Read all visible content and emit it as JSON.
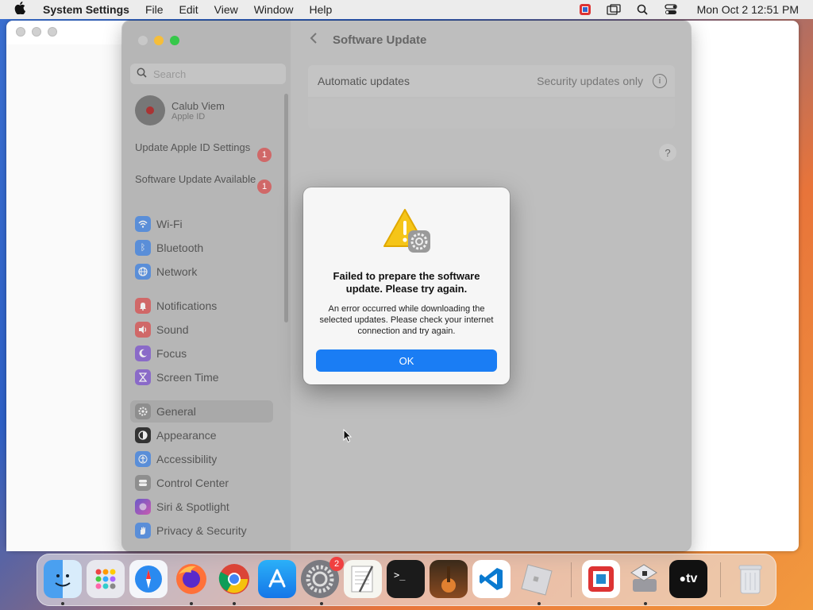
{
  "menubar": {
    "app_name": "System Settings",
    "menus": [
      "File",
      "Edit",
      "View",
      "Window",
      "Help"
    ],
    "clock": "Mon Oct 2  12:51 PM"
  },
  "sidebar": {
    "search_placeholder": "Search",
    "user": {
      "name": "Calub Viem",
      "subtitle": "Apple ID"
    },
    "notices": [
      {
        "label": "Update Apple ID Settings",
        "badge": "1"
      },
      {
        "label": "Software Update Available",
        "badge": "1"
      }
    ],
    "items": [
      {
        "label": "Wi-Fi",
        "icon": "wifi-icon",
        "color": "#5a8ed8"
      },
      {
        "label": "Bluetooth",
        "icon": "bluetooth-icon",
        "color": "#5a8ed8"
      },
      {
        "label": "Network",
        "icon": "globe-icon",
        "color": "#5a8ed8"
      },
      {
        "label": "Notifications",
        "icon": "bell-icon",
        "color": "#d06868"
      },
      {
        "label": "Sound",
        "icon": "speaker-icon",
        "color": "#d06868"
      },
      {
        "label": "Focus",
        "icon": "moon-icon",
        "color": "#8a6ac8"
      },
      {
        "label": "Screen Time",
        "icon": "hourglass-icon",
        "color": "#8a6ac8"
      },
      {
        "label": "General",
        "icon": "gear-icon",
        "color": "#8e8e8e"
      },
      {
        "label": "Appearance",
        "icon": "appearance-icon",
        "color": "#333333"
      },
      {
        "label": "Accessibility",
        "icon": "accessibility-icon",
        "color": "#5a8ed8"
      },
      {
        "label": "Control Center",
        "icon": "control-center-icon",
        "color": "#8e8e8e"
      },
      {
        "label": "Siri & Spotlight",
        "icon": "siri-icon",
        "color": "#8a6ac8"
      },
      {
        "label": "Privacy & Security",
        "icon": "hand-icon",
        "color": "#5a8ed8"
      }
    ]
  },
  "content": {
    "title": "Software Update",
    "auto_updates_label": "Automatic updates",
    "auto_updates_value": "Security updates only",
    "help": "?"
  },
  "dialog": {
    "title": "Failed to prepare the software update. Please try again.",
    "message": "An error occurred while downloading the selected updates. Please check your internet connection and try again.",
    "ok_label": "OK"
  },
  "dock": {
    "settings_badge": "2",
    "appletv_label": "tv"
  }
}
